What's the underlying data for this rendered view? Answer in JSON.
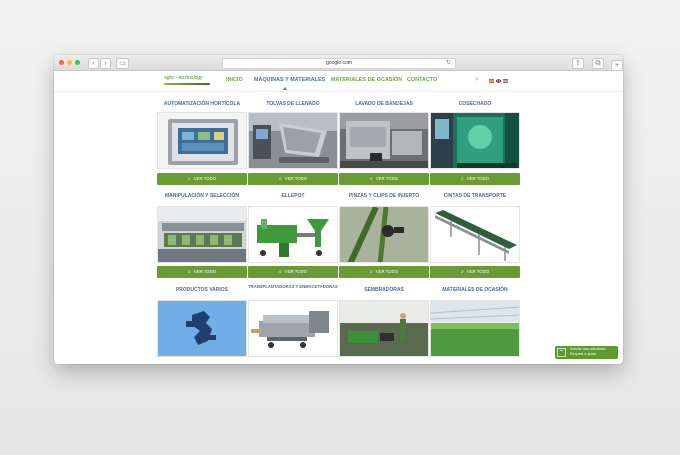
{
  "browser": {
    "url": "google.com",
    "plus_label": "+"
  },
  "nav": {
    "logo_text": "agro - technology",
    "items": [
      "INICIO",
      "MÁQUINAS Y MATERIALES",
      "MATERIALES DE OCASIÓN",
      "CONTACTO"
    ],
    "active_index": 1
  },
  "colors": {
    "accent_green": "#6a9b35",
    "title_blue": "#4b6ba3",
    "nav_green": "#6fa52e"
  },
  "categories": [
    {
      "title": "AUTOMATIZACIÓN HORTÍCOLA",
      "button": "VER TODO"
    },
    {
      "title": "TOLVAS DE LLENADO",
      "button": "VER TODO"
    },
    {
      "title": "LAVADO DE BANDEJAS",
      "button": "VER TODO"
    },
    {
      "title": "COSECHADO",
      "button": "VER TODO"
    },
    {
      "title": "MANIPULACIÓN Y SELECCIÓN",
      "button": "VER TODO"
    },
    {
      "title": "ELLEPOT",
      "button": "VER TODO"
    },
    {
      "title": "PINZAS Y CLIPS DE INJERTO",
      "button": "VER TODO"
    },
    {
      "title": "CINTAS DE TRANSPORTE",
      "button": "VER TODO"
    },
    {
      "title": "PRODUCTOS VARIOS"
    },
    {
      "title": "TRANSPLANTADORAS Y ENMACETADORAS"
    },
    {
      "title": "SEMBRADORAS"
    },
    {
      "title": "MATERIALES DE OCASIÓN"
    }
  ],
  "quote": {
    "line1": "Solicite una cotización",
    "line2": "Request a quote"
  }
}
